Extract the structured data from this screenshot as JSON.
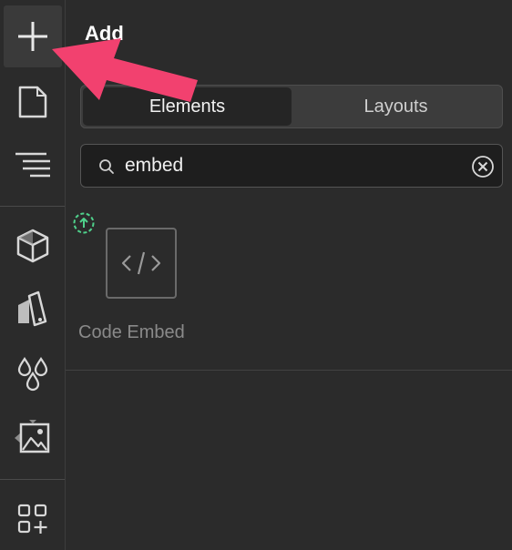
{
  "rail": {
    "items": [
      {
        "name": "add",
        "icon": "plus-icon"
      },
      {
        "name": "pages",
        "icon": "page-icon"
      },
      {
        "name": "navigator",
        "icon": "navigator-icon"
      },
      {
        "name": "components",
        "icon": "cube-icon"
      },
      {
        "name": "style-manager",
        "icon": "paint-bucket-icon"
      },
      {
        "name": "variables",
        "icon": "droplets-icon"
      },
      {
        "name": "assets",
        "icon": "image-icon"
      },
      {
        "name": "apps",
        "icon": "apps-icon"
      }
    ]
  },
  "panel": {
    "title": "Add",
    "tabs": [
      {
        "label": "Elements",
        "active": true
      },
      {
        "label": "Layouts",
        "active": false
      }
    ],
    "search": {
      "value": "embed",
      "placeholder": "Search"
    },
    "results": [
      {
        "label": "Code Embed",
        "icon": "code-icon"
      }
    ]
  },
  "colors": {
    "background": "#2b2b2b",
    "active_rail": "#3a3a3a",
    "annotation_arrow": "#f2416f",
    "upgrade_badge": "#4fd18b"
  }
}
